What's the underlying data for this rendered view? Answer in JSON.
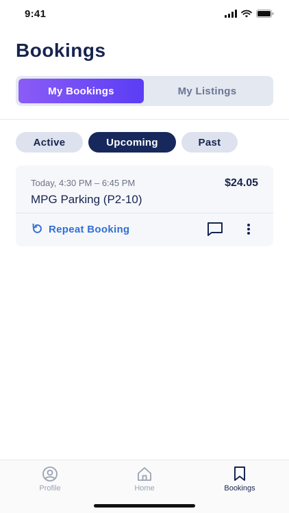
{
  "status_bar": {
    "time": "9:41"
  },
  "header": {
    "title": "Bookings"
  },
  "segmented": {
    "my_bookings": "My Bookings",
    "my_listings": "My Listings"
  },
  "filters": {
    "active": "Active",
    "upcoming": "Upcoming",
    "past": "Past"
  },
  "booking": {
    "time_range": "Today, 4:30 PM – 6:45 PM",
    "price": "$24.05",
    "title": "MPG Parking (P2-10)",
    "repeat_label": "Repeat Booking"
  },
  "tabbar": {
    "profile": "Profile",
    "home": "Home",
    "bookings": "Bookings"
  },
  "colors": {
    "accent_purple": "#8b5cf6",
    "navy": "#16285c",
    "link_blue": "#2f6fd6"
  },
  "icons": [
    "signal-icon",
    "wifi-icon",
    "battery-icon",
    "repeat-icon",
    "chat-icon",
    "more-vertical-icon",
    "profile-icon",
    "home-icon",
    "bookmark-icon"
  ]
}
